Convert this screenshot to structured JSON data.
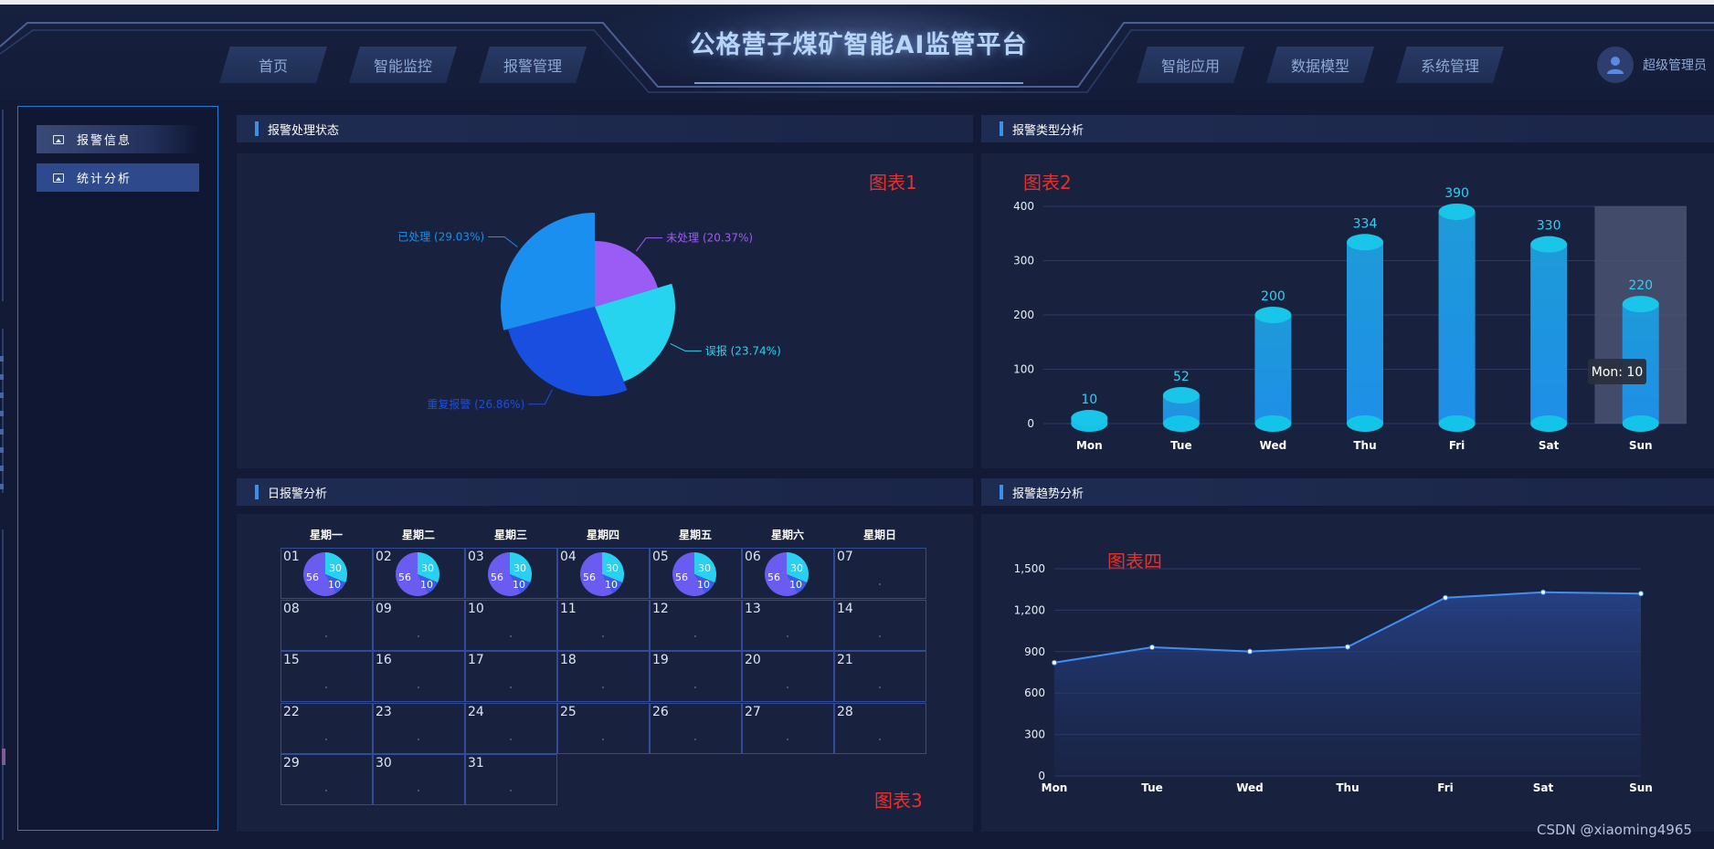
{
  "header": {
    "title": "公格营子煤矿智能AI监管平台",
    "nav_left": [
      "首页",
      "智能监控",
      "报警管理"
    ],
    "nav_right": [
      "智能应用",
      "数据模型",
      "系统管理"
    ],
    "user": "超级管理员"
  },
  "sidebar": {
    "items": [
      {
        "label": "报警信息",
        "active": false
      },
      {
        "label": "统计分析",
        "active": true
      }
    ]
  },
  "panels": {
    "p1": {
      "title": "报警处理状态",
      "chart_label": "图表1"
    },
    "p2": {
      "title": "报警类型分析",
      "chart_label": "图表2"
    },
    "p3": {
      "title": "日报警分析",
      "chart_label": "图表3"
    },
    "p4": {
      "title": "报警趋势分析",
      "chart_label": "图表四"
    }
  },
  "watermark": "CSDN @xiaoming4965",
  "chart_data": [
    {
      "type": "pie",
      "name": "alarm-status",
      "slices": [
        {
          "label": "未处理 (20.37%)",
          "value": 20.37,
          "color": "#9b5cf6"
        },
        {
          "label": "误报 (23.74%)",
          "value": 23.74,
          "color": "#27d4ef"
        },
        {
          "label": "重复报警 (26.86%)",
          "value": 26.86,
          "color": "#1a4ee0"
        },
        {
          "label": "已处理 (29.03%)",
          "value": 29.03,
          "color": "#1a8ff0"
        }
      ]
    },
    {
      "type": "bar",
      "name": "alarm-type",
      "categories": [
        "Mon",
        "Tue",
        "Wed",
        "Thu",
        "Fri",
        "Sat",
        "Sun"
      ],
      "values": [
        10,
        52,
        200,
        334,
        390,
        330,
        220
      ],
      "yticks": [
        0,
        100,
        200,
        300,
        400
      ],
      "ylim": [
        0,
        400
      ],
      "tooltip": "Mon: 10",
      "highlight_index": 6
    },
    {
      "type": "table",
      "name": "daily-calendar",
      "weekdays": [
        "星期一",
        "星期二",
        "星期三",
        "星期四",
        "星期五",
        "星期六",
        "星期日"
      ],
      "days": [
        "01",
        "02",
        "03",
        "04",
        "05",
        "06",
        "07",
        "08",
        "09",
        "10",
        "11",
        "12",
        "13",
        "14",
        "15",
        "16",
        "17",
        "18",
        "19",
        "20",
        "21",
        "22",
        "23",
        "24",
        "25",
        "26",
        "27",
        "28",
        "29",
        "30",
        "31"
      ],
      "mini_pie_days": 6,
      "mini_pie_values": [
        56,
        30,
        10
      ],
      "mini_pie_colors": [
        "#6a5cf0",
        "#2ad0f0",
        "#3d5be8"
      ]
    },
    {
      "type": "area",
      "name": "alarm-trend",
      "categories": [
        "Mon",
        "Tue",
        "Wed",
        "Thu",
        "Fri",
        "Sat",
        "Sun"
      ],
      "values": [
        820,
        932,
        901,
        934,
        1290,
        1330,
        1320
      ],
      "yticks": [
        "0",
        "300",
        "600",
        "900",
        "1,200",
        "1,500"
      ],
      "ylim": [
        0,
        1500
      ]
    }
  ]
}
